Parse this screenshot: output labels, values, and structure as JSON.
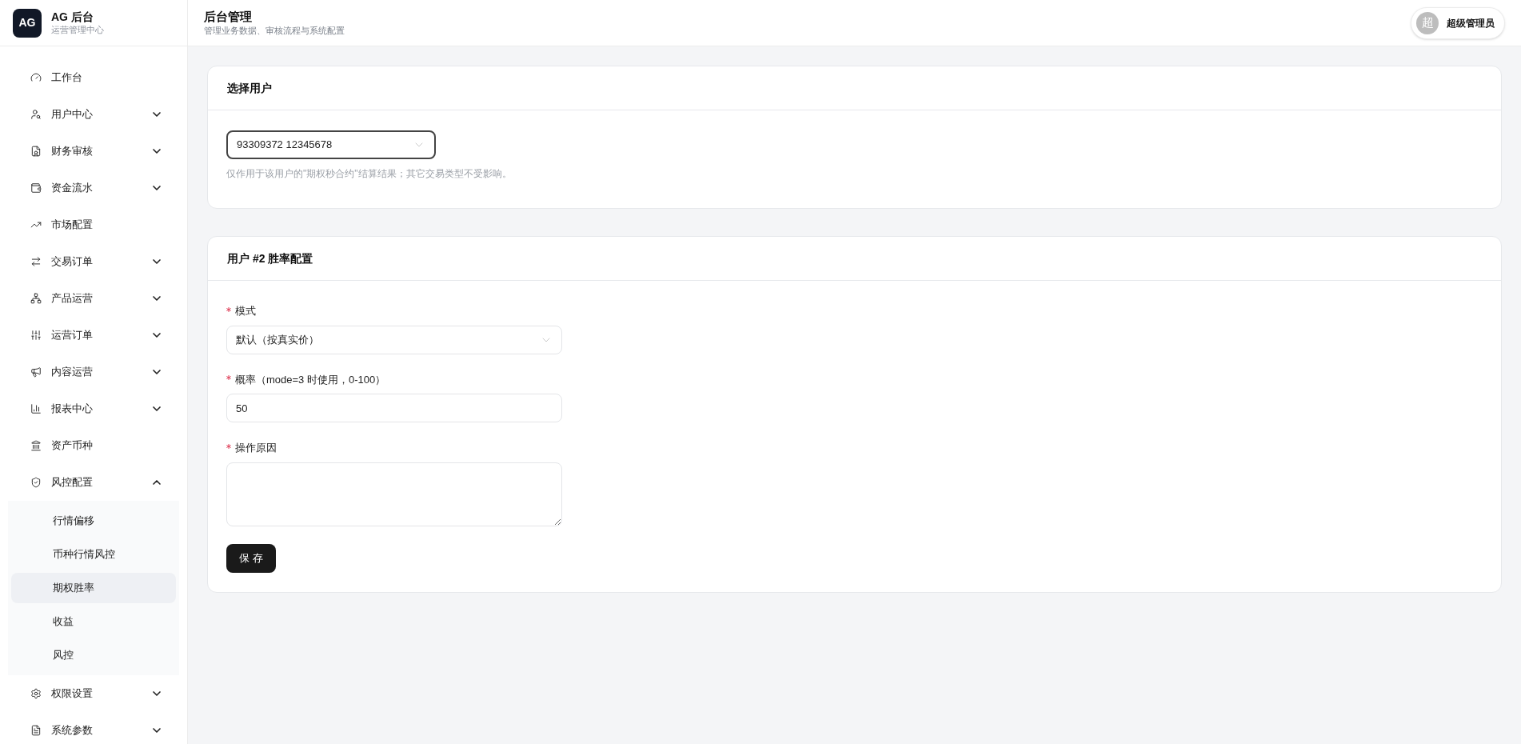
{
  "brand": {
    "logo": "AG",
    "name": "AG 后台",
    "subtitle": "运营管理中心"
  },
  "sidebar": {
    "items": [
      {
        "label": "工作台",
        "kind": "link",
        "selected": false
      },
      {
        "label": "用户中心",
        "kind": "group",
        "expanded": false
      },
      {
        "label": "财务审核",
        "kind": "group",
        "expanded": false
      },
      {
        "label": "资金流水",
        "kind": "group",
        "expanded": false
      },
      {
        "label": "市场配置",
        "kind": "link",
        "selected": false
      },
      {
        "label": "交易订单",
        "kind": "group",
        "expanded": false
      },
      {
        "label": "产品运营",
        "kind": "group",
        "expanded": false
      },
      {
        "label": "运营订单",
        "kind": "group",
        "expanded": false
      },
      {
        "label": "内容运营",
        "kind": "group",
        "expanded": false
      },
      {
        "label": "报表中心",
        "kind": "group",
        "expanded": false
      },
      {
        "label": "资产币种",
        "kind": "link",
        "selected": false
      },
      {
        "label": "风控配置",
        "kind": "group",
        "expanded": true,
        "children": [
          {
            "label": "行情偏移",
            "selected": false
          },
          {
            "label": "币种行情风控",
            "selected": false
          },
          {
            "label": "期权胜率",
            "selected": true
          },
          {
            "label": "收益",
            "selected": false
          },
          {
            "label": "风控",
            "selected": false
          }
        ]
      },
      {
        "label": "权限设置",
        "kind": "group",
        "expanded": false
      },
      {
        "label": "系统参数",
        "kind": "group",
        "expanded": false
      }
    ]
  },
  "header": {
    "title": "后台管理",
    "subtitle": "管理业务数据、审核流程与系统配置",
    "user": {
      "avatar": "超",
      "name": "超级管理员"
    }
  },
  "user_card": {
    "title": "选择用户",
    "select": {
      "value": "93309372 12345678",
      "focused": true
    },
    "hint": "仅作用于该用户的\"期权秒合约\"结算结果；其它交易类型不受影响。"
  },
  "config_card": {
    "title": "用户 #2 胜率配置",
    "fields": [
      {
        "kind": "select",
        "label": "模式",
        "required": true,
        "value": "默认（按真实价）"
      },
      {
        "kind": "input",
        "label": "概率（mode=3 时使用，0-100）",
        "required": true,
        "value": "50"
      },
      {
        "kind": "textarea",
        "label": "操作原因",
        "required": true
      }
    ],
    "save_button": "保 存"
  }
}
